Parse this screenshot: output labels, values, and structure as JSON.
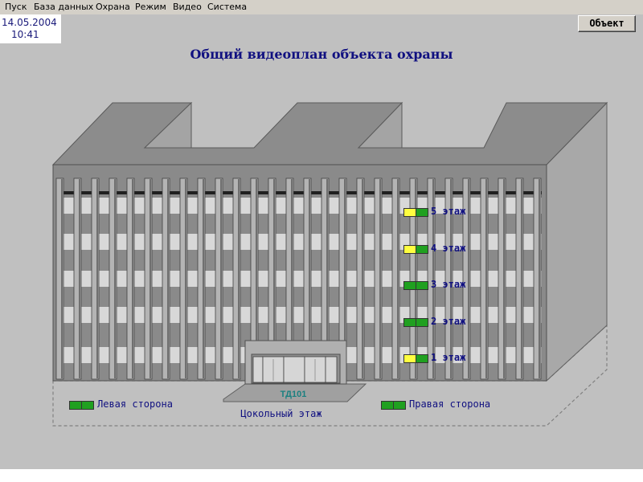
{
  "menu": {
    "items": [
      "Пуск",
      "База данных",
      "Охрана",
      "Режим",
      "Видео",
      "Система"
    ]
  },
  "clock": {
    "date": "14.05.2004",
    "time": "10:41"
  },
  "toolbar": {
    "object_label": "Объект"
  },
  "title": "Общий видеоплан объекта охраны",
  "floors": [
    {
      "label": "5 этаж",
      "indicators": [
        "yellow",
        "green"
      ]
    },
    {
      "label": "4 этаж",
      "indicators": [
        "yellow",
        "green"
      ]
    },
    {
      "label": "3 этаж",
      "indicators": [
        "green",
        "green"
      ]
    },
    {
      "label": "2 этаж",
      "indicators": [
        "green",
        "green"
      ]
    },
    {
      "label": "1 этаж",
      "indicators": [
        "yellow",
        "green"
      ]
    }
  ],
  "sides": {
    "left": "Левая сторона",
    "right": "Правая сторона"
  },
  "basement": "Цокольный этаж",
  "entrance": "ТД101",
  "colors": {
    "label_text": "#101080",
    "indicator_yellow": "#ffff40",
    "indicator_green": "#20a020",
    "entrance_text": "#1a8080"
  }
}
